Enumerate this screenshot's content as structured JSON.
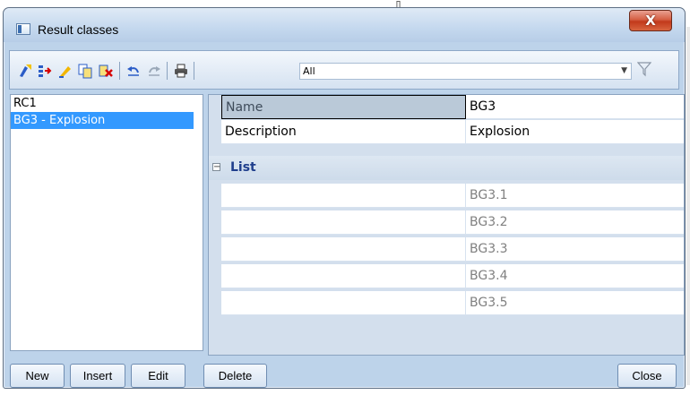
{
  "window": {
    "title": "Result classes",
    "close_glyph": "X"
  },
  "toolbar": {
    "icons": [
      "new-item-icon",
      "move-item-icon",
      "edit-pencil-icon",
      "copy-document-icon",
      "delete-icon",
      "undo-icon",
      "redo-icon",
      "print-icon"
    ],
    "filter_value": "All",
    "filter_icon": "funnel-filter-icon"
  },
  "list": {
    "items": [
      "RC1",
      "BG3 - Explosion"
    ],
    "selected_index": 1
  },
  "properties": {
    "rows": [
      {
        "label": "Name",
        "value": "BG3"
      },
      {
        "label": "Description",
        "value": "Explosion"
      }
    ],
    "group": {
      "label": "List",
      "items": [
        "BG3.1",
        "BG3.2",
        "BG3.3",
        "BG3.4",
        "BG3.5"
      ]
    }
  },
  "buttons": {
    "new": "New",
    "insert": "Insert",
    "edit": "Edit",
    "delete": "Delete",
    "close": "Close"
  },
  "colors": {
    "selection": "#3399ff",
    "group_label": "#1f3e8c",
    "close_button": "#c2391b"
  }
}
